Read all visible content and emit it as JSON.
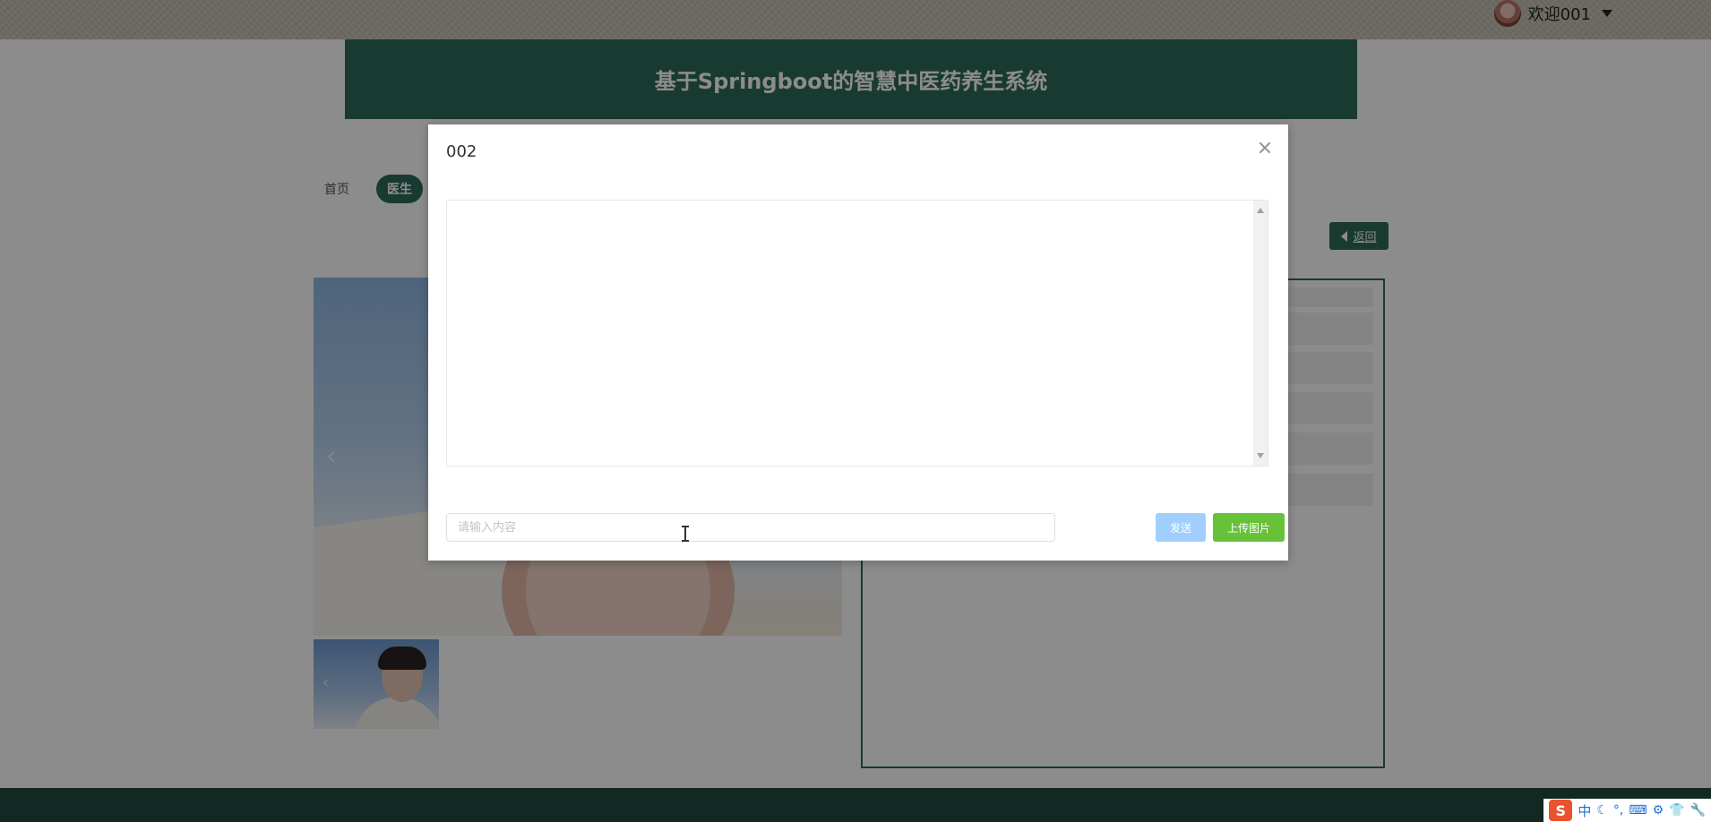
{
  "header": {
    "welcome_text": "欢迎001",
    "site_title": "基于Springboot的智慧中医药养生系统"
  },
  "nav": {
    "items": [
      {
        "label": "首页"
      },
      {
        "label": "医生"
      }
    ]
  },
  "detail": {
    "back_label": "返回"
  },
  "modal": {
    "title": "002",
    "input_placeholder": "请输入内容",
    "send_label": "发送",
    "upload_label": "上传图片"
  },
  "system_tray": {
    "ime_logo": "S",
    "ime_mode": "中"
  },
  "colors": {
    "brand": "#2f6b5a",
    "send": "#a0cfff",
    "upload": "#67c23a"
  }
}
